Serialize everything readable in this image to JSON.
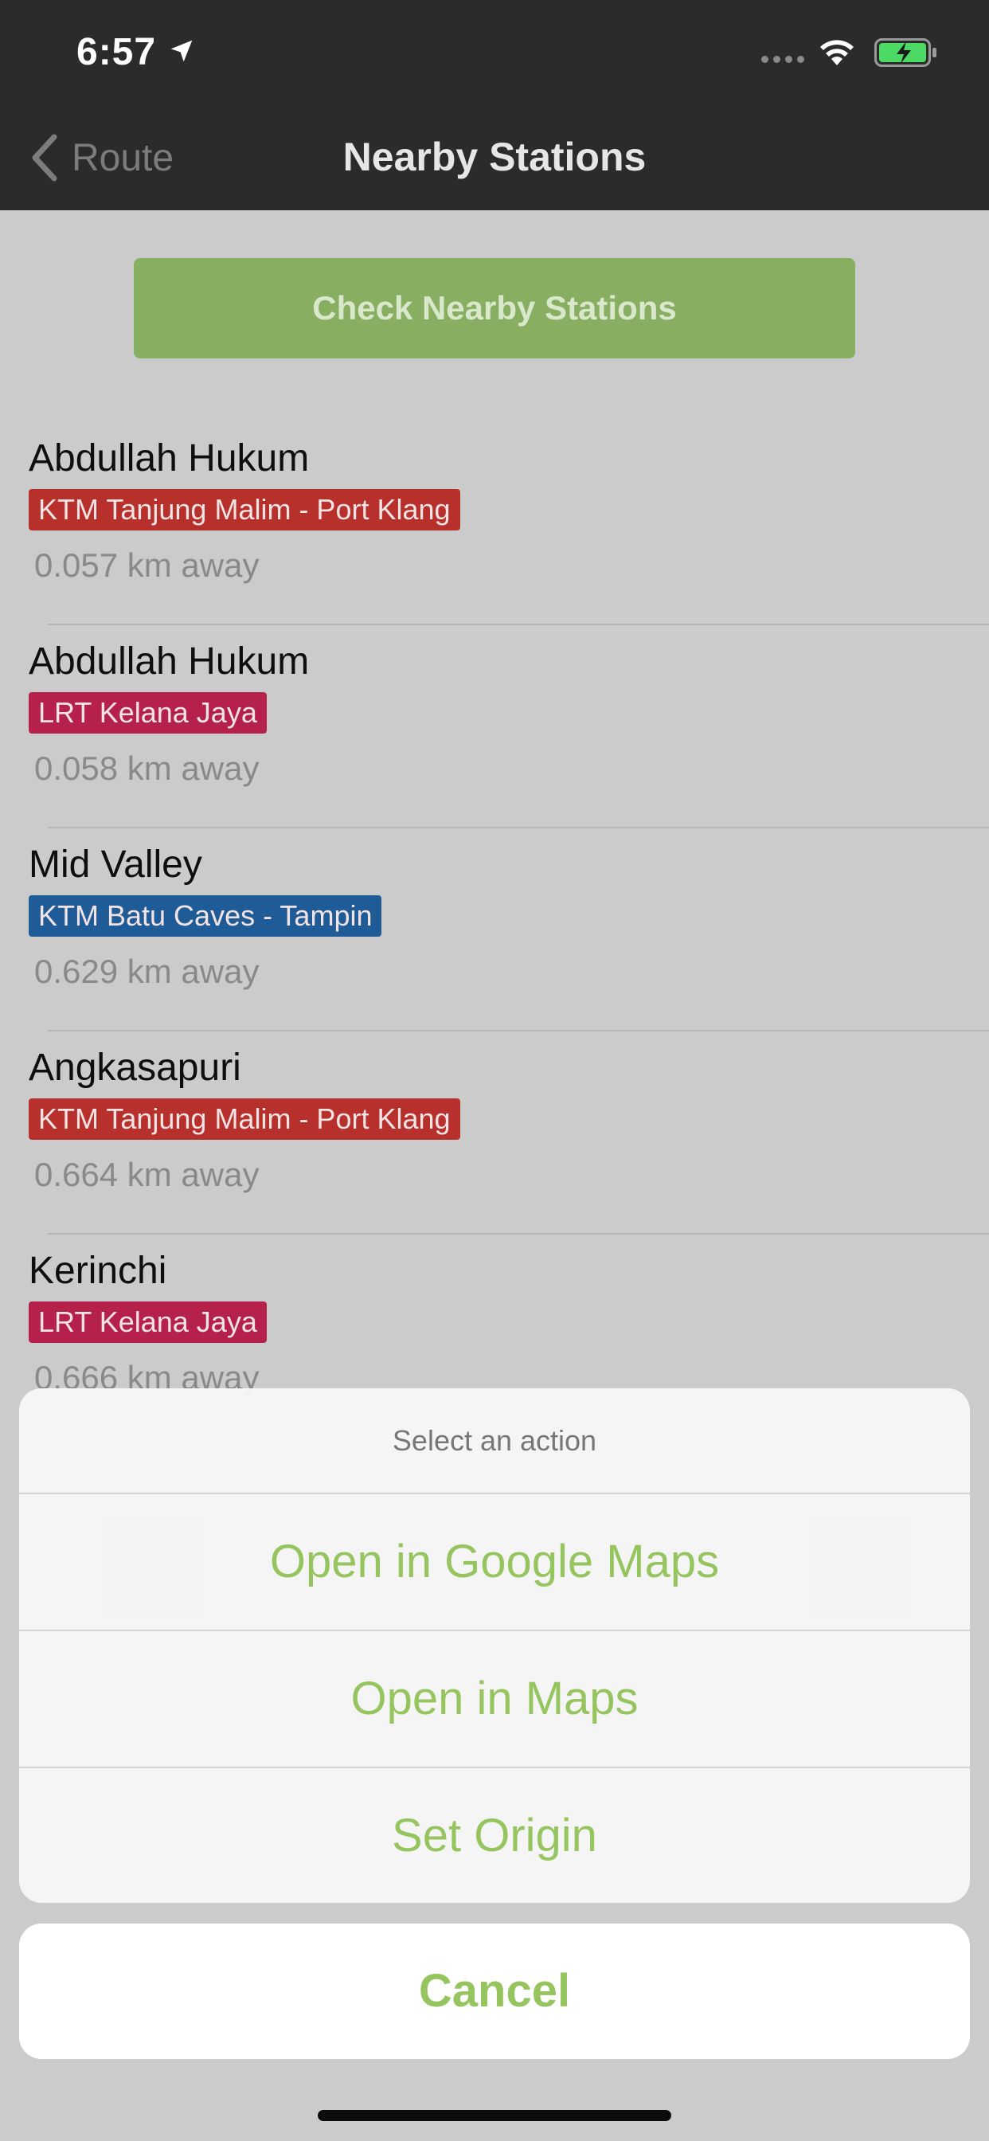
{
  "status": {
    "time": "6:57",
    "location_icon": "location-arrow-icon",
    "wifi_icon": "wifi-icon",
    "battery_icon": "battery-charging-icon",
    "battery_color": "#4cd964"
  },
  "nav": {
    "back_label": "Route",
    "title": "Nearby Stations"
  },
  "check_button": {
    "label": "Check Nearby Stations",
    "color": "#88ae62"
  },
  "stations": [
    {
      "name": "Abdullah Hukum",
      "line": "KTM Tanjung Malim - Port Klang",
      "line_color": "#b8302b",
      "distance": "0.057 km away"
    },
    {
      "name": "Abdullah Hukum",
      "line": "LRT Kelana Jaya",
      "line_color": "#b5214a",
      "distance": "0.058 km away"
    },
    {
      "name": "Mid Valley",
      "line": "KTM Batu Caves - Tampin",
      "line_color": "#1f5b96",
      "distance": "0.629 km away"
    },
    {
      "name": "Angkasapuri",
      "line": "KTM Tanjung Malim - Port Klang",
      "line_color": "#b8302b",
      "distance": "0.664 km away"
    },
    {
      "name": "Kerinchi",
      "line": "LRT Kelana Jaya",
      "line_color": "#b5214a",
      "distance": "0.666 km away"
    }
  ],
  "action_sheet": {
    "title": "Select an action",
    "items": [
      "Open in Google Maps",
      "Open in Maps",
      "Set Origin"
    ],
    "cancel": "Cancel",
    "accent_color": "#96c560"
  }
}
